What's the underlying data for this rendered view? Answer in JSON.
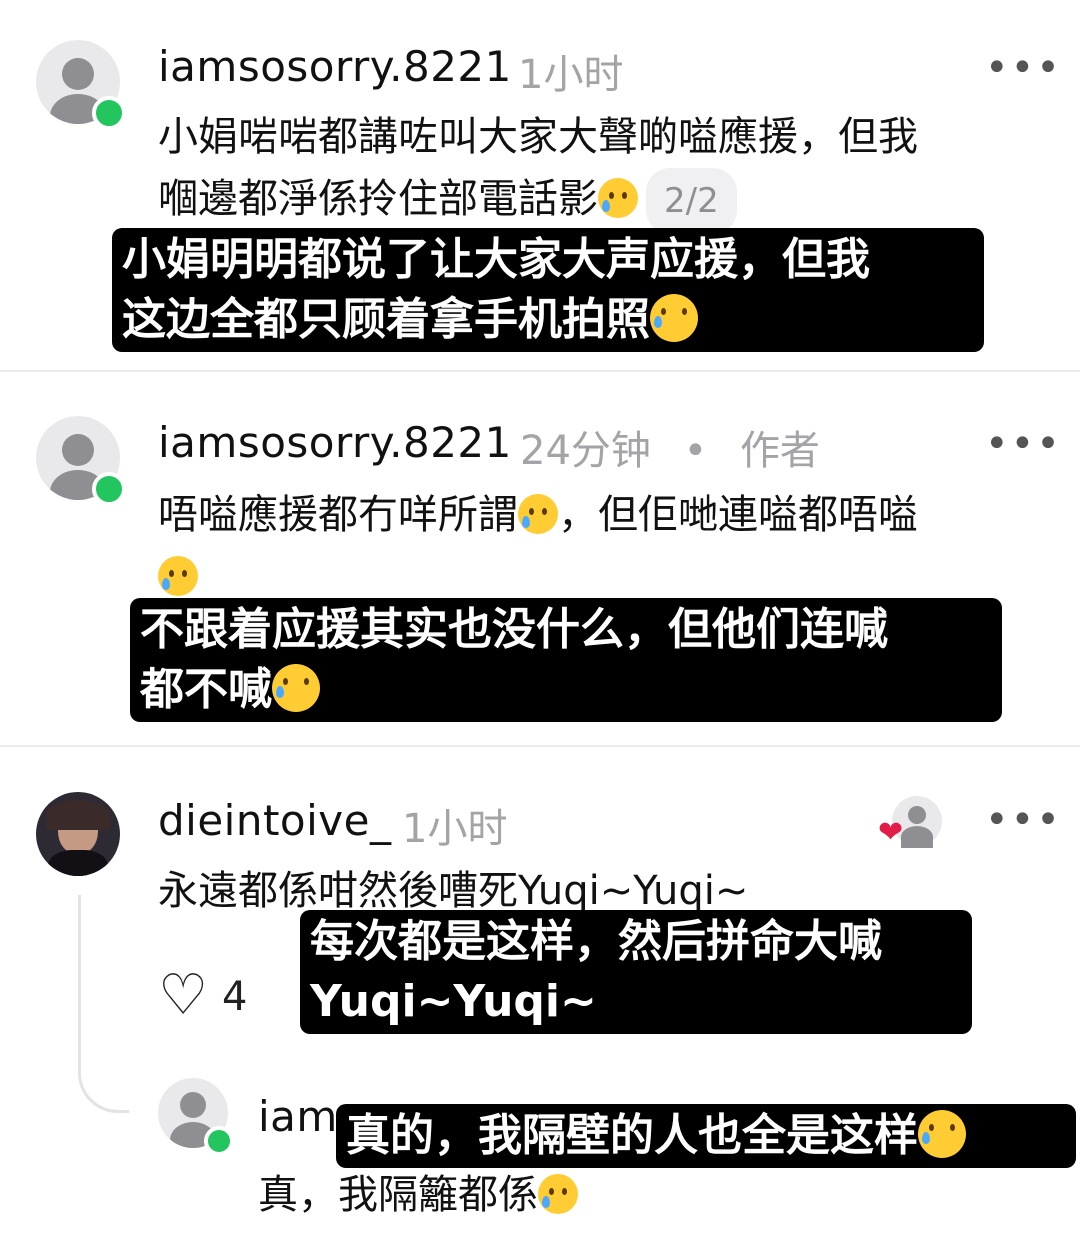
{
  "comments": [
    {
      "username": "iamsosorry.8221",
      "time": "1小时",
      "more": "•••",
      "text_line1": "小娟啱啱都講咗叫大家大聲啲嗌應援，但我",
      "text_line2": "嗰邊都淨係拎住部電話影",
      "page_badge": "2/2",
      "caption_line1": "小娟明明都说了让大家大声应援，但我",
      "caption_line2": "这边全都只顾着拿手机拍照"
    },
    {
      "username": "iamsosorry.8221",
      "time": "24分钟",
      "dot": "•",
      "author_tag": "作者",
      "more": "•••",
      "text_line1": "唔嗌應援都冇咩所謂",
      "text_line1b": "，但佢哋連嗌都唔嗌",
      "caption_line1": "不跟着应援其实也没什么，但他们连喊",
      "caption_line2": "都不喊"
    },
    {
      "username": "dieintoive_",
      "time": "1小时",
      "more": "•••",
      "text_line1": "永遠都係咁然後嘈死Yuqi~Yuqi~",
      "like_count": "4",
      "caption_line1": "每次都是这样，然后拼命大喊",
      "caption_line2": "Yuqi~Yuqi~"
    },
    {
      "username_partial": "iam",
      "text_line1": "真，我隔籬都係",
      "caption_line1": "真的，我隔壁的人也全是这样"
    }
  ],
  "icons": {
    "more": "more-icon",
    "heart": "heart-icon",
    "online": "online-status-icon",
    "emoji_tear_smile": "smiling-face-with-tear-icon",
    "emoji_crying": "loudly-crying-face-icon"
  },
  "colors": {
    "online": "#22c55e",
    "meta": "#a3a3a8",
    "liked_heart": "#e11d48"
  }
}
